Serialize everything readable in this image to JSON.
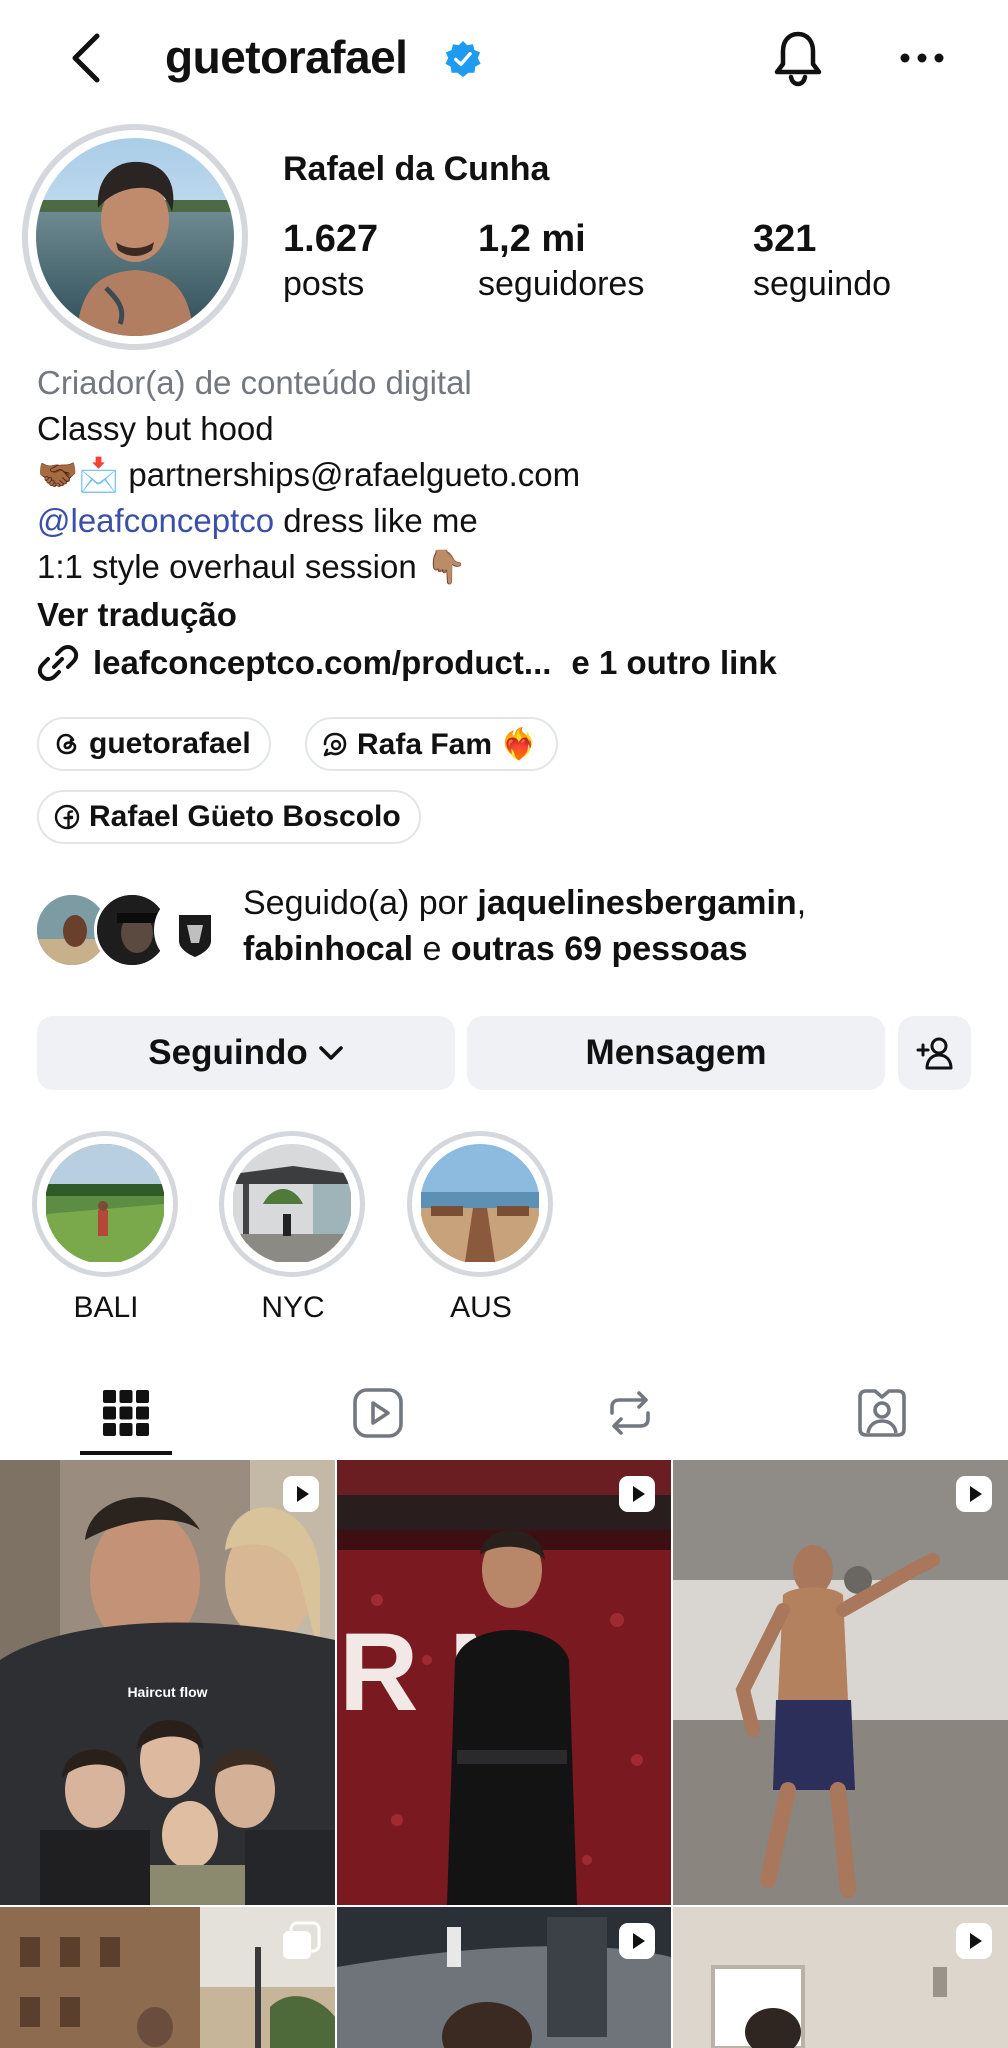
{
  "header": {
    "username": "guetorafael",
    "back_icon": "back-chevron-icon",
    "verified_icon": "verified-badge-icon",
    "notifications_icon": "bell-icon",
    "more_icon": "more-dots-icon"
  },
  "profile": {
    "full_name": "Rafael da Cunha",
    "stats": [
      {
        "value": "1.627",
        "label": "posts"
      },
      {
        "value": "1,2 mi",
        "label": "seguidores"
      },
      {
        "value": "321",
        "label": "seguindo"
      }
    ],
    "category": "Criador(a) de conteúdo digital",
    "bio_line1": "Classy but hood",
    "bio_line2_emoji": "🤝🏾📩",
    "bio_line2_text": " partnerships@rafaelgueto.com",
    "bio_line3_mention": "@leafconceptco",
    "bio_line3_text": " dress like me",
    "bio_line4_text": "1:1 style overhaul session ",
    "bio_line4_emoji": "👇🏽",
    "translate": "Ver tradução",
    "link_text": "leafconceptco.com/product...",
    "other_links": "e 1 outro link"
  },
  "chips": {
    "threads": "guetorafael",
    "channel": "Rafa Fam ❤️‍🔥",
    "facebook": "Rafael Güeto Boscolo"
  },
  "followed_by": {
    "prefix": "Seguido(a) por ",
    "user1": "jaquelinesbergamin",
    "comma": ",",
    "user2": "fabinhocal",
    "and": " e ",
    "others": "outras 69 pessoas"
  },
  "buttons": {
    "following": "Seguindo",
    "message": "Mensagem",
    "add_person_icon": "add-person-icon"
  },
  "highlights": [
    {
      "label": "BALI"
    },
    {
      "label": "NYC"
    },
    {
      "label": "AUS"
    }
  ],
  "tabs": [
    "grid-icon",
    "reels-icon",
    "reposts-icon",
    "tagged-icon"
  ],
  "posts": {
    "post1_caption": "Haircut flow",
    "post2_sign": "R N"
  },
  "colors": {
    "accent_link": "#3a4fa8",
    "verified": "#1d9bf0",
    "button_bg": "#eff1f4",
    "muted_text": "#737880"
  }
}
